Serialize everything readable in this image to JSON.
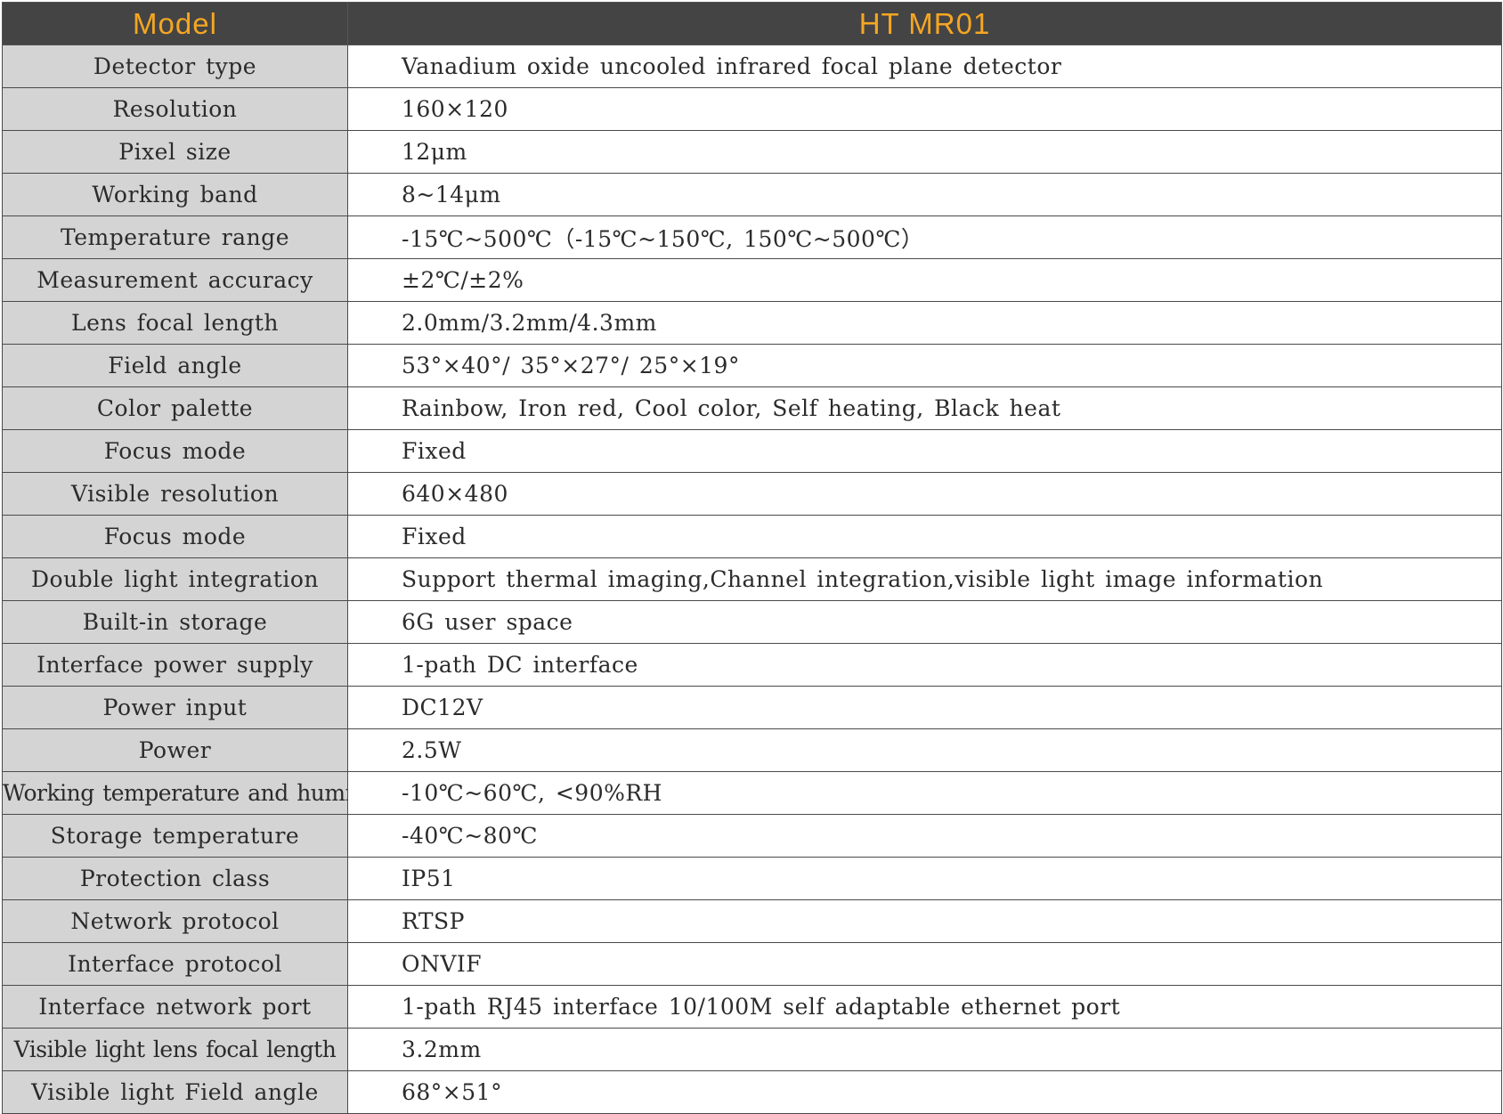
{
  "header": {
    "model_label": "Model",
    "model_value": "HT MR01"
  },
  "rows": [
    {
      "label": "Detector type",
      "value": "Vanadium oxide uncooled infrared focal plane detector"
    },
    {
      "label": "Resolution",
      "value": "160×120"
    },
    {
      "label": "Pixel size",
      "value": "12μm"
    },
    {
      "label": "Working band",
      "value": "8~14μm"
    },
    {
      "label": "Temperature range",
      "value": "-15℃~500℃（-15℃~150℃, 150℃~500℃）"
    },
    {
      "label": "Measurement accuracy",
      "value": "±2℃/±2%"
    },
    {
      "label": "Lens focal length",
      "value": "2.0mm/3.2mm/4.3mm"
    },
    {
      "label": "Field angle",
      "value": "53°×40°/ 35°×27°/ 25°×19°"
    },
    {
      "label": "Color palette",
      "value": "Rainbow, Iron red, Cool color, Self heating, Black heat"
    },
    {
      "label": "Focus mode",
      "value": "Fixed"
    },
    {
      "label": "Visible resolution",
      "value": "640×480"
    },
    {
      "label": "Focus mode",
      "value": "Fixed"
    },
    {
      "label": "Double light integration",
      "value": "Support thermal imaging,Channel integration,visible light image information"
    },
    {
      "label": "Built-in storage",
      "value": "6G user space"
    },
    {
      "label": "Interface power supply",
      "value": "1-path DC interface"
    },
    {
      "label": "Power input",
      "value": "DC12V"
    },
    {
      "label": "Power",
      "value": "2.5W"
    },
    {
      "label": "Working temperature and humidity",
      "value": "-10℃~60℃, <90%RH"
    },
    {
      "label": "Storage temperature",
      "value": "-40℃~80℃"
    },
    {
      "label": "Protection class",
      "value": "IP51"
    },
    {
      "label": "Network protocol",
      "value": "RTSP"
    },
    {
      "label": "Interface protocol",
      "value": "ONVIF"
    },
    {
      "label": "Interface network port",
      "value": "1-path RJ45 interface 10/100M self adaptable ethernet port"
    },
    {
      "label": "Visible light lens focal length",
      "value": "3.2mm"
    },
    {
      "label": "Visible light Field angle",
      "value": "68°×51°"
    }
  ]
}
